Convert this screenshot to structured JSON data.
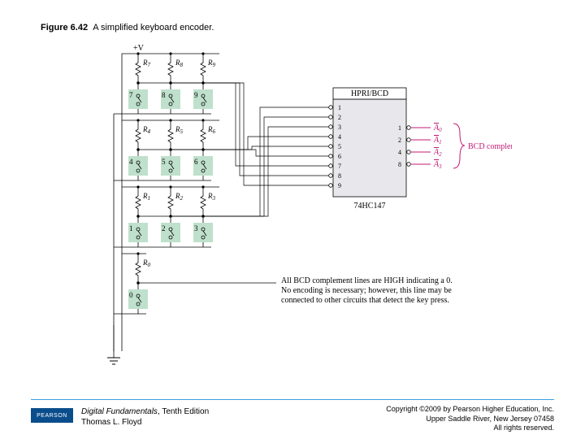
{
  "caption": {
    "fig": "Figure 6.42",
    "text": "A simplified keyboard encoder."
  },
  "power": "+V",
  "resistors": {
    "r7": "R",
    "r8": "R",
    "r9": "R",
    "r4": "R",
    "r5": "R",
    "r6": "R",
    "r1": "R",
    "r2": "R",
    "r3": "R",
    "r0": "R"
  },
  "resistor_sub": {
    "r7": "7",
    "r8": "8",
    "r9": "9",
    "r4": "4",
    "r5": "5",
    "r6": "6",
    "r1": "1",
    "r2": "2",
    "r3": "3",
    "r0": "0"
  },
  "keys": {
    "k7": "7",
    "k8": "8",
    "k9": "9",
    "k4": "4",
    "k5": "5",
    "k6": "6",
    "k1": "1",
    "k2": "2",
    "k3": "3",
    "k0": "0"
  },
  "encoder": {
    "title": "HPRI/BCD",
    "part": "74HC147",
    "in_labels": [
      "1",
      "2",
      "3",
      "4",
      "5",
      "6",
      "7",
      "8",
      "9"
    ],
    "out_labels": [
      "1",
      "2",
      "4",
      "8"
    ],
    "out_names_base": "A",
    "out_names_sub": [
      "0",
      "1",
      "2",
      "3"
    ],
    "annotation": "BCD complement"
  },
  "note": {
    "l1": "All BCD complement lines are HIGH indicating a 0.",
    "l2": "No encoding is necessary; however, this line may be",
    "l3": "connected to other circuits that detect the key press."
  },
  "footer": {
    "pearson": "PEARSON",
    "book": "Digital Fundamentals",
    "edition": ", Tenth Edition",
    "author": "Thomas L. Floyd",
    "c1": "Copyright ©2009 by Pearson Higher Education, Inc.",
    "c2": "Upper Saddle River, New Jersey 07458",
    "c3": "All rights reserved."
  }
}
